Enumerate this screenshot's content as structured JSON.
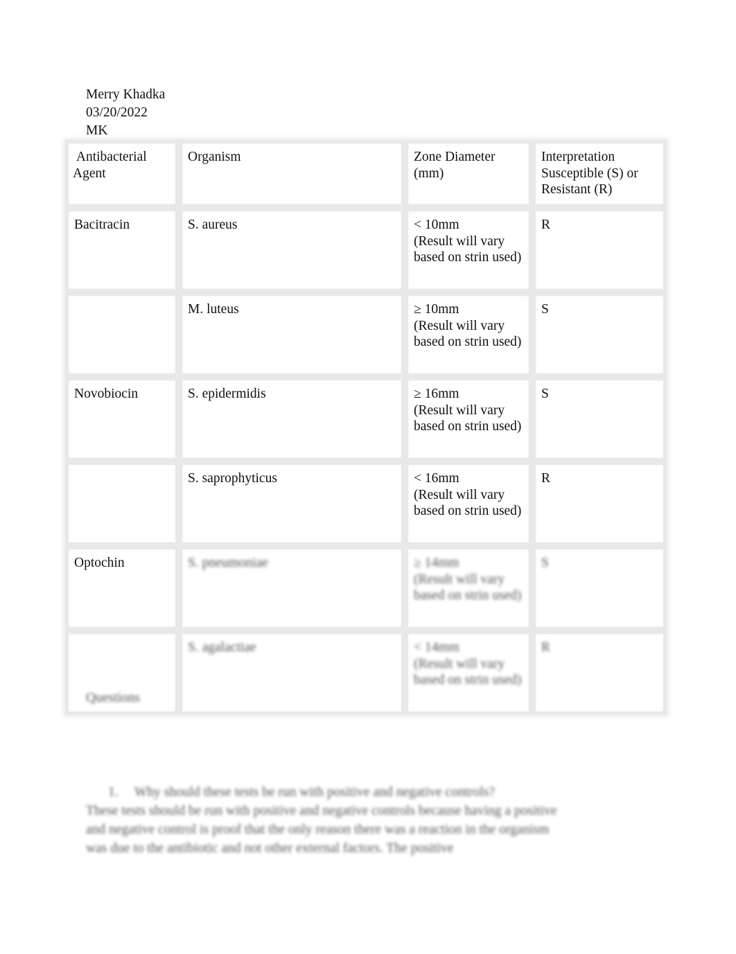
{
  "header": {
    "name": "Merry Khadka",
    "date": "03/20/2022",
    "initials": "MK"
  },
  "table": {
    "columns": [
      " Antibacterial Agent",
      "Organism",
      "Zone Diameter (mm)",
      "Interpretation Susceptible (S) or Resistant (R)"
    ],
    "rows": [
      {
        "agent": "Bacitracin",
        "organism": "S. aureus",
        "zone": "< 10mm",
        "note": "(Result will vary based on strin used)",
        "interpretation": "R"
      },
      {
        "agent": "",
        "organism": "M. luteus",
        "zone": "≥ 10mm",
        "note": "(Result will vary based on strin used)",
        "interpretation": "S"
      },
      {
        "agent": "Novobiocin",
        "organism": "S. epidermidis",
        "zone": "≥ 16mm",
        "note": "(Result will vary based on strin used)",
        "interpretation": "S"
      },
      {
        "agent": "",
        "organism": "S. saprophyticus",
        "zone": "< 16mm",
        "note": "(Result will vary based on strin used)",
        "interpretation": "R"
      },
      {
        "agent": "Optochin",
        "organism": "S. pneumoniae",
        "zone": "≥ 14mm",
        "note": "(Result will vary based on strin used)",
        "interpretation": "S"
      },
      {
        "agent": "",
        "organism": "S. agalactiae",
        "zone": "< 14mm",
        "note": "(Result will vary based on strin used)",
        "interpretation": "R"
      }
    ]
  },
  "questions": {
    "label": "Questions",
    "items": [
      {
        "number": "1.",
        "question": "Why should these tests be run with positive and negative controls?",
        "answer": "These tests should be run with positive and negative controls because having a positive and negative control is proof that the only reason there was a reaction in the organism was due to the antibiotic and not other external factors. The positive"
      }
    ]
  }
}
